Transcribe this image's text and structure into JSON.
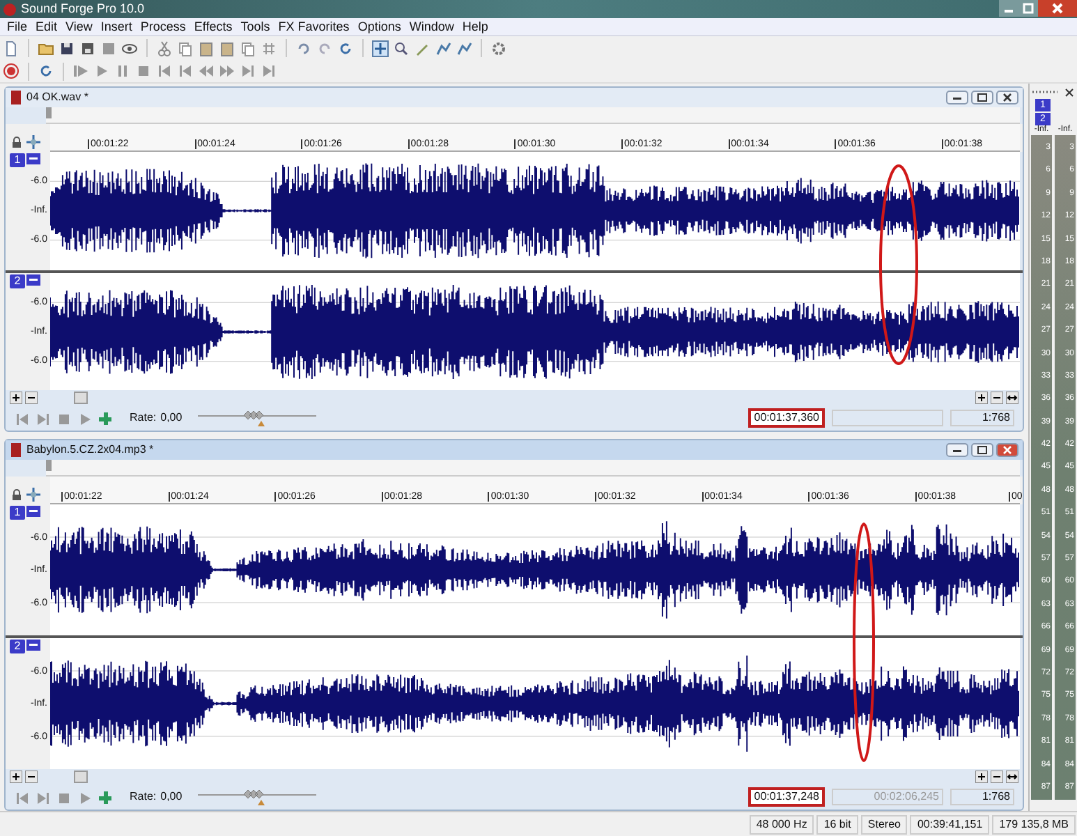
{
  "window": {
    "title": "Sound Forge Pro 10.0"
  },
  "menu": [
    "File",
    "Edit",
    "View",
    "Insert",
    "Process",
    "Effects",
    "Tools",
    "FX Favorites",
    "Options",
    "Window",
    "Help"
  ],
  "documents": [
    {
      "title": "04 OK.wav *",
      "active": false,
      "ruler": [
        "00:01:22",
        "00:01:24",
        "00:01:26",
        "00:01:28",
        "00:01:30",
        "00:01:32",
        "00:01:34",
        "00:01:36",
        "00:01:38"
      ],
      "channels": [
        {
          "number": "1",
          "scale": [
            "-6.0",
            "-Inf.",
            "-6.0"
          ]
        },
        {
          "number": "2",
          "scale": [
            "-6.0",
            "-Inf.",
            "-6.0"
          ]
        }
      ],
      "rate_label": "Rate:",
      "rate": "0,00",
      "rate_slider": {
        "level": 0.5
      },
      "selection_start": "00:01:37,360",
      "zoom": "1:768"
    },
    {
      "title": "Babylon.5.CZ.2x04.mp3 *",
      "active": true,
      "ruler": [
        "00:01:22",
        "00:01:24",
        "00:01:26",
        "00:01:28",
        "00:01:30",
        "00:01:32",
        "00:01:34",
        "00:01:36",
        "00:01:38",
        "00"
      ],
      "channels": [
        {
          "number": "1",
          "scale": [
            "-6.0",
            "-Inf.",
            "-6.0"
          ]
        },
        {
          "number": "2",
          "scale": [
            "-6.0",
            "-Inf.",
            "-6.0"
          ]
        }
      ],
      "rate_label": "Rate:",
      "rate": "0,00",
      "rate_slider": {
        "level": 0.5
      },
      "selection_start": "00:01:37,248",
      "length": "00:02:06,245",
      "zoom": "1:768"
    }
  ],
  "meters": {
    "channels": [
      "1",
      "2"
    ],
    "columns": [
      {
        "reading": "-Inf.",
        "scale": [
          "3",
          "6",
          "9",
          "12",
          "15",
          "18",
          "21",
          "24",
          "27",
          "30",
          "33",
          "36",
          "39",
          "42",
          "45",
          "48",
          "51",
          "54",
          "57",
          "60",
          "63",
          "66",
          "69",
          "72",
          "75",
          "78",
          "81",
          "84",
          "87"
        ]
      },
      {
        "reading": "-Inf.",
        "scale": [
          "3",
          "6",
          "9",
          "12",
          "15",
          "18",
          "21",
          "24",
          "27",
          "30",
          "33",
          "36",
          "39",
          "42",
          "45",
          "48",
          "51",
          "54",
          "57",
          "60",
          "63",
          "66",
          "69",
          "72",
          "75",
          "78",
          "81",
          "84",
          "87"
        ]
      }
    ]
  },
  "status_bar": [
    "48 000 Hz",
    "16 bit",
    "Stereo",
    "00:39:41,151",
    "179 135,8 MB"
  ]
}
